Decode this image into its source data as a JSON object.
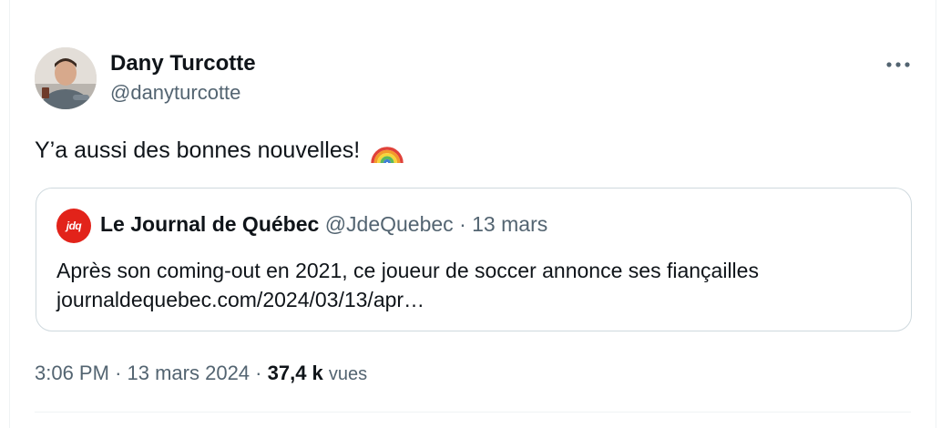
{
  "author": {
    "name": "Dany Turcotte",
    "handle": "@danyturcotte"
  },
  "icons": {
    "more": "more-options-icon",
    "emoji": "rainbow-emoji"
  },
  "tweet": {
    "text": "Y’a aussi des bonnes nouvelles!"
  },
  "quote": {
    "avatar_text": "jdq",
    "name": "Le Journal de Québec",
    "handle": "@JdeQuebec",
    "separator": "·",
    "date": "13 mars",
    "line1": "Après son coming-out en 2021, ce joueur de soccer annonce ses fiançailles",
    "line2": "journaldequebec.com/2024/03/13/apr…"
  },
  "footer": {
    "time": "3:06 PM",
    "sep1": "·",
    "date": "13 mars 2024",
    "sep2": "·",
    "views_count": "37,4 k",
    "views_label": "vues"
  },
  "colors": {
    "text": "#0f1419",
    "secondary": "#536471",
    "border": "#cfd9de",
    "jdq_red": "#e2231a"
  }
}
